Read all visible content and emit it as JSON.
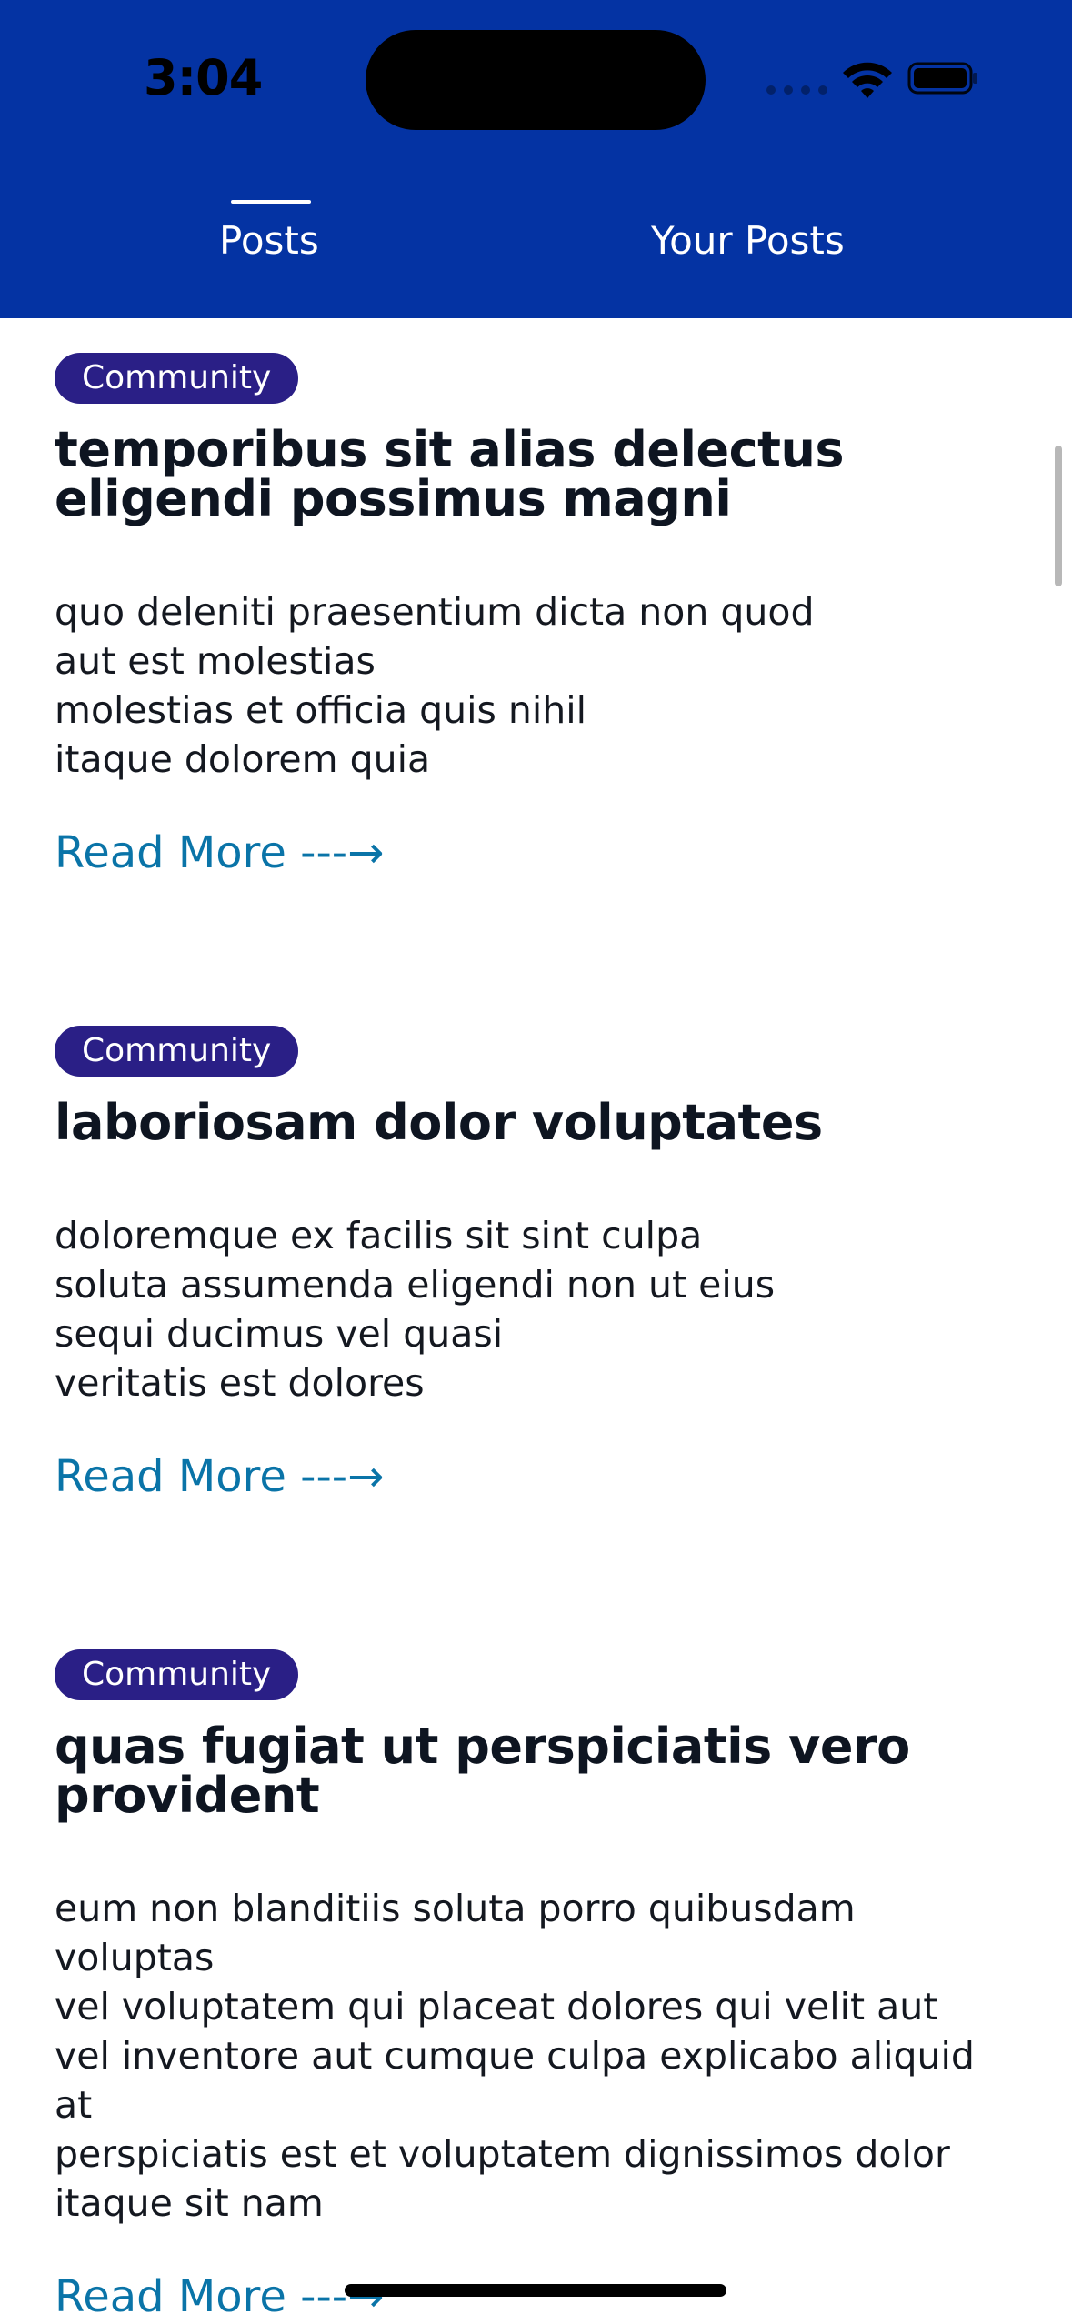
{
  "status_bar": {
    "time": "3:04"
  },
  "tabs": [
    {
      "label": "Posts",
      "selected": true
    },
    {
      "label": "Your Posts",
      "selected": false
    }
  ],
  "posts": [
    {
      "category": "Community",
      "title": "temporibus sit alias delectus eligendi possimus magni",
      "body": [
        "quo deleniti praesentium dicta non quod",
        "aut est molestias",
        "molestias et officia quis nihil",
        "itaque dolorem quia"
      ],
      "read_more": "Read More ---→"
    },
    {
      "category": "Community",
      "title": "laboriosam dolor voluptates",
      "body": [
        "doloremque ex facilis sit sint culpa",
        "soluta assumenda eligendi non ut eius",
        "sequi ducimus vel quasi",
        "veritatis est dolores"
      ],
      "read_more": "Read More ---→"
    },
    {
      "category": "Community",
      "title": "quas fugiat ut perspiciatis vero provident",
      "body": [
        "eum non blanditiis soluta porro quibusdam",
        "voluptas",
        "vel voluptatem qui placeat dolores qui velit aut",
        "vel inventore aut cumque culpa explicabo aliquid",
        "at",
        "perspiciatis est et voluptatem dignissimos dolor",
        "itaque sit nam"
      ],
      "read_more": "Read More ---→"
    }
  ],
  "colors": {
    "header_bg": "#0433a3",
    "badge_bg": "#2a1f86",
    "link": "#0a74a8",
    "title": "#0e1521"
  },
  "icons": {
    "wifi": "wifi-icon",
    "battery": "battery-icon",
    "signal": "signal-icon"
  }
}
